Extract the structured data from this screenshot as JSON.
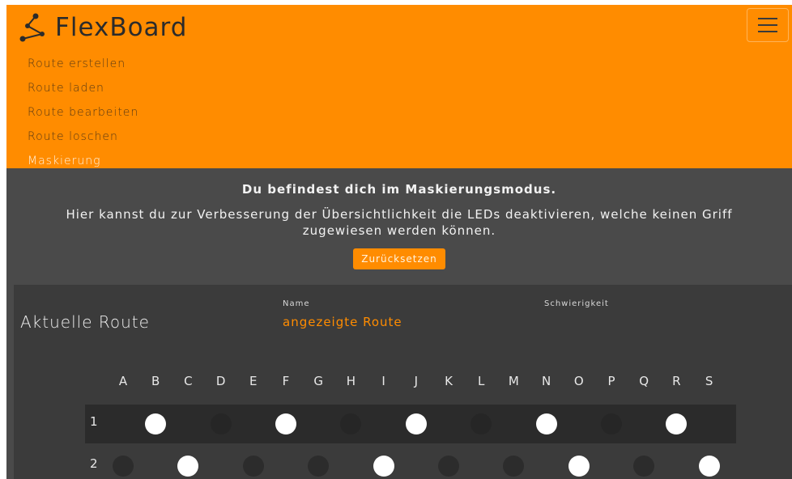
{
  "brand": {
    "name": "FlexBoard",
    "icon": "route-graph-icon"
  },
  "nav": {
    "items": [
      {
        "label": "Route erstellen"
      },
      {
        "label": "Route laden"
      },
      {
        "label": "Route bearbeiten"
      },
      {
        "label": "Route loschen"
      },
      {
        "label": "Maskierung",
        "active": true
      }
    ]
  },
  "info": {
    "title": "Du befindest dich im Maskierungsmodus.",
    "text": "Hier kannst du zur Verbesserung der Übersichtlichkeit die LEDs deaktivieren, welche keinen Griff zugewiesen werden können.",
    "reset_label": "Zurücksetzen"
  },
  "route": {
    "heading": "Aktuelle Route",
    "name_label": "Name",
    "name_value": "angezeigte Route",
    "difficulty_label": "Schwierigkeit"
  },
  "grid": {
    "columns": [
      "A",
      "B",
      "C",
      "D",
      "E",
      "F",
      "G",
      "H",
      "I",
      "J",
      "K",
      "L",
      "M",
      "N",
      "O",
      "P",
      "Q",
      "R",
      "S"
    ],
    "rows": [
      {
        "label": "1",
        "leds": [
          "off",
          "on",
          "off",
          "dim",
          "off",
          "on",
          "off",
          "dim",
          "off",
          "on",
          "off",
          "dim",
          "off",
          "on",
          "off",
          "dim",
          "off",
          "on",
          "off"
        ]
      },
      {
        "label": "2",
        "leds": [
          "dark",
          "off",
          "on",
          "off",
          "dark",
          "off",
          "dark",
          "off",
          "on",
          "off",
          "dark",
          "off",
          "dark",
          "off",
          "on",
          "off",
          "dark",
          "off",
          "on"
        ]
      }
    ]
  },
  "colors": {
    "accent": "#ff8c00",
    "background": "#4a4a4a",
    "card": "#3b3b3b",
    "led_on": "#ffffff"
  }
}
